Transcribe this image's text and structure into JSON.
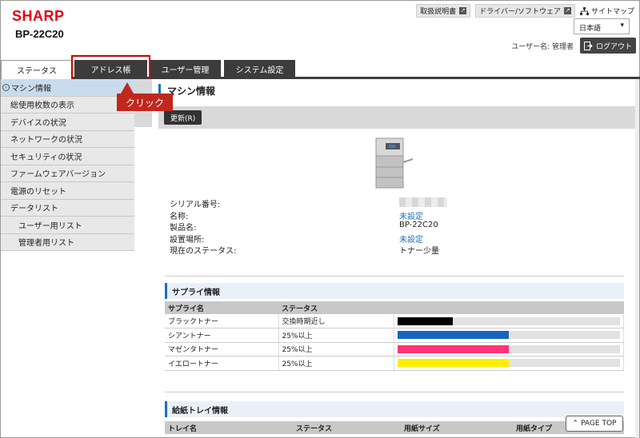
{
  "header": {
    "logo": "SHARP",
    "model": "BP-22C20",
    "links": [
      {
        "label": "取扱説明書",
        "icon": "external-link-icon"
      },
      {
        "label": "ドライバー/ソフトウェア",
        "icon": "external-link-icon"
      }
    ],
    "sitemap": "サイトマップ",
    "language": "日本語",
    "user_line": "ユーザー名: 管理者",
    "logout": "ログアウト"
  },
  "tabs": [
    {
      "label": "ステータス",
      "active": true
    },
    {
      "label": "アドレス帳",
      "active": false
    },
    {
      "label": "ユーザー管理",
      "active": false
    },
    {
      "label": "システム設定",
      "active": false
    }
  ],
  "callout": "クリック",
  "sidebar": {
    "items": [
      {
        "label": "マシン情報",
        "active": true,
        "sub": false
      },
      {
        "label": "総使用枚数の表示",
        "active": false,
        "sub": false
      },
      {
        "label": "デバイスの状況",
        "active": false,
        "sub": false
      },
      {
        "label": "ネットワークの状況",
        "active": false,
        "sub": false
      },
      {
        "label": "セキュリティの状況",
        "active": false,
        "sub": false
      },
      {
        "label": "ファームウェアバージョン",
        "active": false,
        "sub": false
      },
      {
        "label": "電源のリセット",
        "active": false,
        "sub": false
      },
      {
        "label": "データリスト",
        "active": false,
        "sub": false
      },
      {
        "label": "ユーザー用リスト",
        "active": false,
        "sub": true
      },
      {
        "label": "管理者用リスト",
        "active": false,
        "sub": true
      }
    ]
  },
  "main": {
    "title": "マシン情報",
    "refresh": "更新(R)",
    "info": [
      {
        "label": "シリアル番号:",
        "value": "",
        "type": "blur"
      },
      {
        "label": "名称:",
        "value": "未設定",
        "type": "link"
      },
      {
        "label": "製品名:",
        "value": "BP-22C20",
        "type": "text"
      },
      {
        "label": "設置場所:",
        "value": "未設定",
        "type": "link"
      },
      {
        "label": "現在のステータス:",
        "value": "トナー少量",
        "type": "text"
      }
    ],
    "supply": {
      "title": "サプライ情報",
      "headers": [
        "サプライ名",
        "ステータス",
        ""
      ],
      "rows": [
        {
          "name": "ブラックトナー",
          "status": "交換時期近し",
          "level": 0.25,
          "color": "#000000"
        },
        {
          "name": "シアントナー",
          "status": "25%以上",
          "level": 0.5,
          "color": "#1565c0"
        },
        {
          "name": "マゼンタトナー",
          "status": "25%以上",
          "level": 0.5,
          "color": "#ff3377"
        },
        {
          "name": "イエロートナー",
          "status": "25%以上",
          "level": 0.5,
          "color": "#ffee00"
        }
      ]
    },
    "tray": {
      "title": "給紙トレイ情報",
      "headers": [
        "トレイ名",
        "ステータス",
        "用紙サイズ",
        "用紙タイプ"
      ]
    }
  },
  "page_top": "PAGE TOP"
}
